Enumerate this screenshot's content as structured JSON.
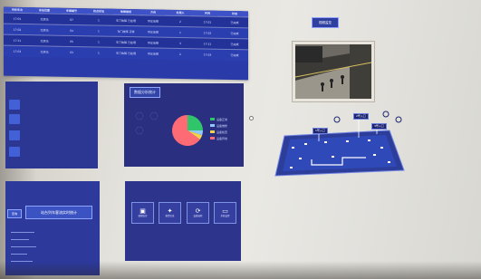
{
  "table": {
    "headers": [
      "列车车次",
      "车站位置",
      "车厢编号",
      "终点车站",
      "故障描述",
      "方向",
      "处理人",
      "时间",
      "状态"
    ],
    "rows": [
      [
        "17:01",
        "北京站",
        "07",
        "1",
        "车门故障 已处理",
        "列车故障",
        "2",
        "17:01",
        "已完成"
      ],
      [
        "17:02",
        "北京站",
        "04",
        "1",
        "车门故障 正常",
        "列车故障",
        "1",
        "17:02",
        "已完成"
      ],
      [
        "17:11",
        "北京站",
        "05",
        "1",
        "车门故障 已处理",
        "列车故障",
        "3",
        "17:11",
        "已完成"
      ],
      [
        "17:03",
        "北京站",
        "03",
        "1",
        "车门故障 已处理",
        "列车故障",
        "2",
        "17:03",
        "已完成"
      ]
    ]
  },
  "chart_panel": {
    "title": "数据分析统计"
  },
  "chart_data": {
    "type": "pie",
    "title": "数据分析统计",
    "categories": [
      "设备正常",
      "设备维修",
      "设备检查",
      "设备异常"
    ],
    "values": [
      25,
      5,
      5,
      65
    ],
    "colors": [
      "#31c56b",
      "#8fc9ff",
      "#f2d14b",
      "#ff6b74"
    ]
  },
  "left_bottom": {
    "button_label": "查询",
    "title": "站台列车客流实时统计"
  },
  "actions": {
    "items": [
      {
        "label": "视频监控",
        "icon": "camera-icon",
        "glyph": "▣"
      },
      {
        "label": "报警信息",
        "icon": "star-icon",
        "glyph": "✦"
      },
      {
        "label": "设备巡检",
        "icon": "refresh-icon",
        "glyph": "⟳"
      },
      {
        "label": "系统设置",
        "icon": "monitor-icon",
        "glyph": "▭"
      }
    ]
  },
  "right_panel": {
    "camera_title": "视频监控",
    "map_labels": [
      "1号入口",
      "2号入口",
      "3号入口"
    ]
  },
  "colors": {
    "panel": "#2a2f80",
    "panel_light": "#3d52c7",
    "accent": "#8fa6ff"
  }
}
